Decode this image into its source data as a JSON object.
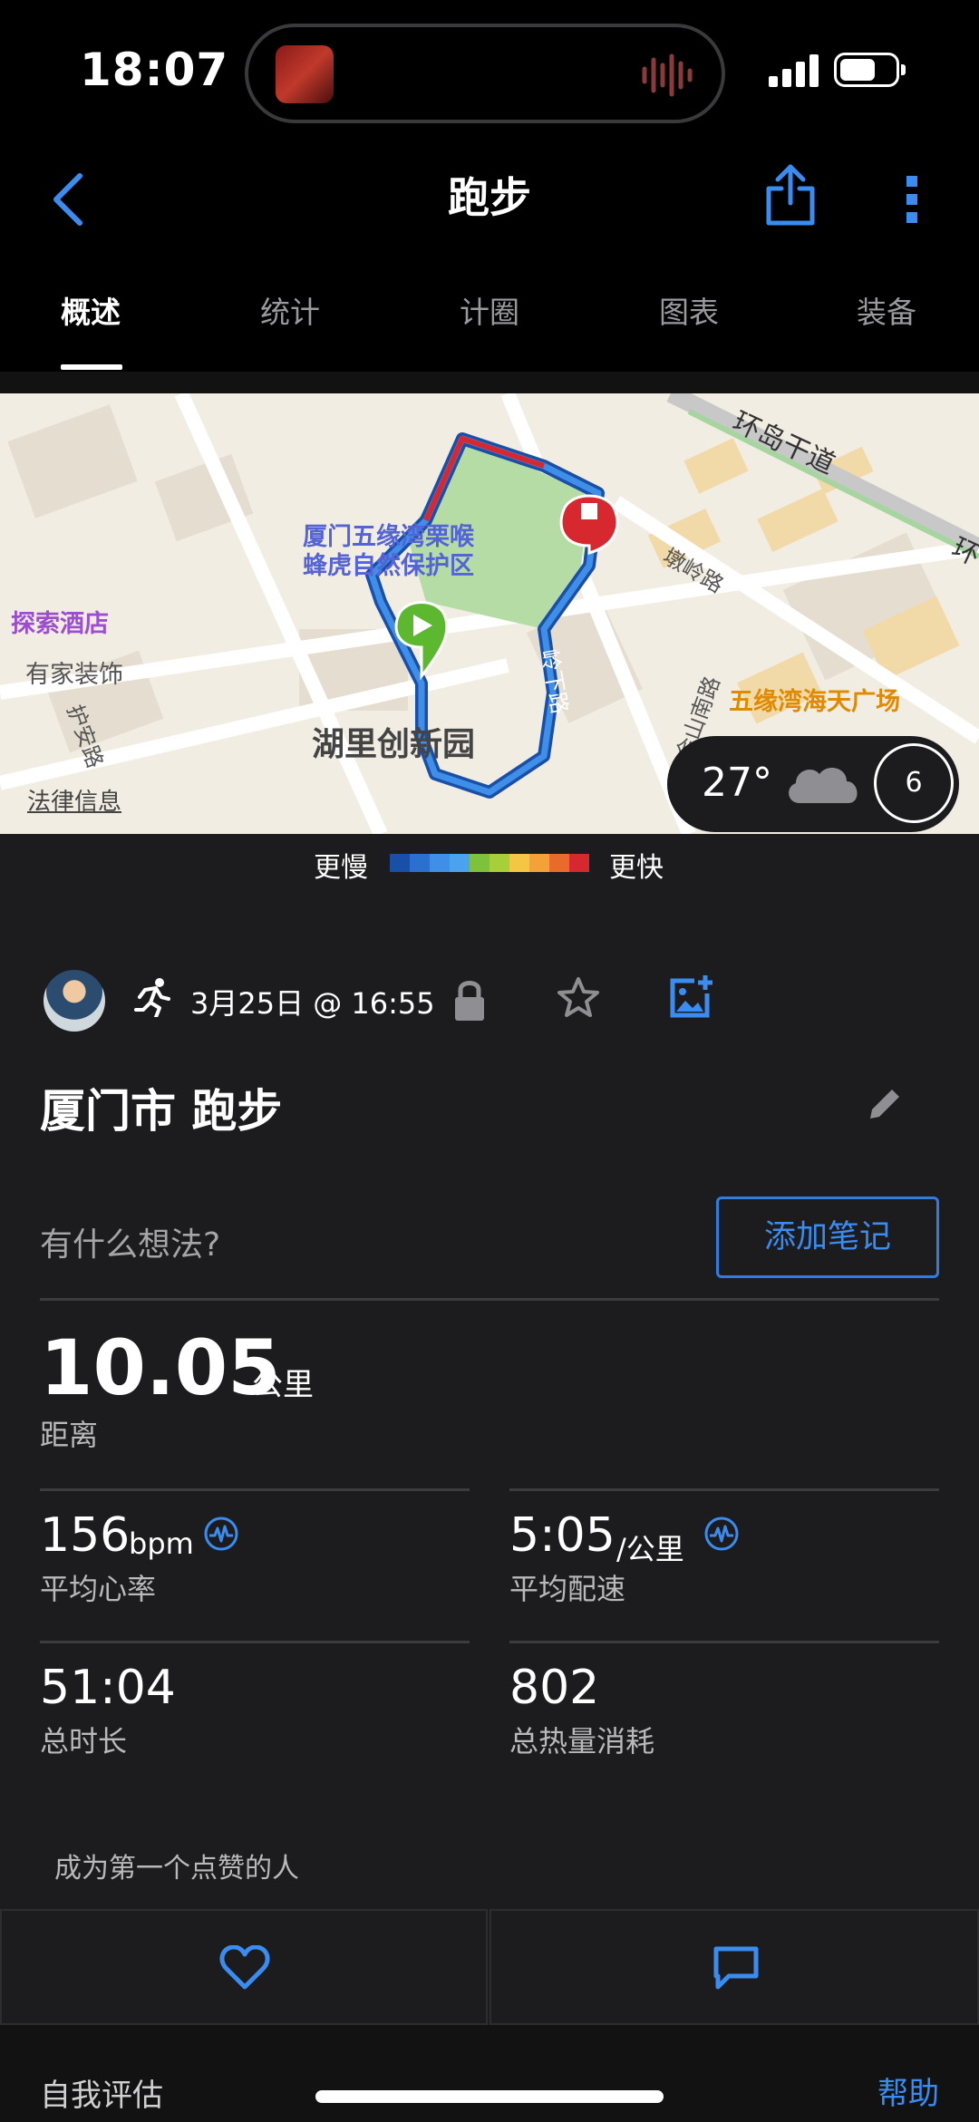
{
  "status_bar": {
    "time": "18:07"
  },
  "nav": {
    "title": "跑步"
  },
  "tabs": [
    {
      "label": "概述",
      "active": true
    },
    {
      "label": "统计",
      "active": false
    },
    {
      "label": "计圈",
      "active": false
    },
    {
      "label": "图表",
      "active": false
    },
    {
      "label": "装备",
      "active": false
    }
  ],
  "map": {
    "labels": {
      "reserve_line1": "厦门五缘湾栗喉",
      "reserve_line2": "蜂虎自然保护区",
      "hotel": "探索酒店",
      "decor": "有家装饰",
      "park": "湖里创新园",
      "plaza": "五缘湾海天广场",
      "road_huandao": "环岛干道",
      "road_dunling": "墩岭路",
      "road_jinshan": "金山南路",
      "road_huan": "护安路",
      "road_ling": "岭下路",
      "road_huan2": "环"
    },
    "legal": "法律信息",
    "weather": {
      "temperature": "27°",
      "wind": "6"
    }
  },
  "speed_legend": {
    "slow": "更慢",
    "fast": "更快",
    "colors": [
      "#1a4fa8",
      "#2b6fd1",
      "#3f8fe8",
      "#4aa3ee",
      "#7dc13c",
      "#a6cf3a",
      "#f3c744",
      "#f3a23a",
      "#ea6a2b",
      "#d8282f"
    ]
  },
  "activity": {
    "date": "3月25日 @ 16:55",
    "title": "厦门市 跑步",
    "thoughts_placeholder": "有什么想法?",
    "add_note": "添加笔记"
  },
  "stats": {
    "distance": {
      "value": "10.05",
      "unit": "公里",
      "label": "距离"
    },
    "heart_rate": {
      "value": "156",
      "unit": "bpm",
      "label": "平均心率"
    },
    "pace": {
      "value": "5:05",
      "unit": "/公里",
      "label": "平均配速"
    },
    "duration": {
      "value": "51:04",
      "label": "总时长"
    },
    "calories": {
      "value": "802",
      "label": "总热量消耗"
    }
  },
  "social": {
    "likes_text": "成为第一个点赞的人"
  },
  "footer": {
    "self_eval": "自我评估",
    "help": "帮助"
  },
  "accent": "#3a8cf0"
}
